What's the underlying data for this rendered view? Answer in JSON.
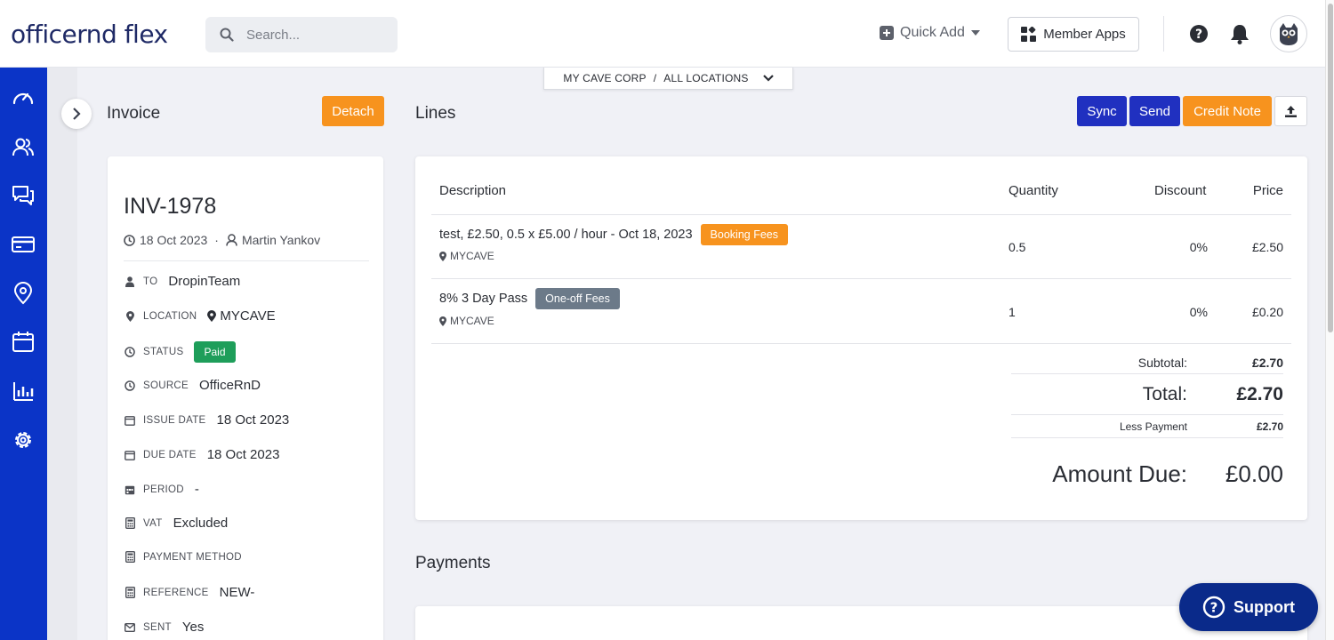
{
  "brand": {
    "logo_text": "officernd flex"
  },
  "header": {
    "search_placeholder": "Search...",
    "quick_add_label": "Quick Add",
    "member_apps_label": "Member Apps"
  },
  "breadcrumb": {
    "company": "MY CAVE CORP",
    "separator": "/",
    "location": "ALL LOCATIONS"
  },
  "invoice": {
    "section_title": "Invoice",
    "detach_label": "Detach",
    "number": "INV-1978",
    "date": "18 Oct 2023",
    "meta_separator": "·",
    "author": "Martin Yankov",
    "fields": {
      "to": {
        "label": "TO",
        "value": "DropinTeam"
      },
      "location": {
        "label": "LOCATION",
        "value": "MYCAVE"
      },
      "status": {
        "label": "STATUS",
        "value": "Paid"
      },
      "source": {
        "label": "SOURCE",
        "value": "OfficeRnD"
      },
      "issue_date": {
        "label": "ISSUE DATE",
        "value": "18 Oct 2023"
      },
      "due_date": {
        "label": "DUE DATE",
        "value": "18 Oct 2023"
      },
      "period": {
        "label": "PERIOD",
        "value": "-"
      },
      "vat": {
        "label": "VAT",
        "value": "Excluded"
      },
      "payment_method": {
        "label": "PAYMENT METHOD",
        "value": ""
      },
      "reference": {
        "label": "REFERENCE",
        "value": "NEW-"
      },
      "sent": {
        "label": "SENT",
        "value": "Yes"
      }
    }
  },
  "lines": {
    "section_title": "Lines",
    "actions": {
      "sync": "Sync",
      "send": "Send",
      "credit_note": "Credit Note"
    },
    "columns": {
      "description": "Description",
      "quantity": "Quantity",
      "discount": "Discount",
      "price": "Price"
    },
    "rows": [
      {
        "description": "test, £2.50, 0.5 x £5.00 / hour - Oct 18, 2023",
        "tag": "Booking Fees",
        "tag_color": "#f7931e",
        "location": "MYCAVE",
        "quantity": "0.5",
        "discount": "0%",
        "price": "£2.50"
      },
      {
        "description": "8% 3 Day Pass",
        "tag": "One-off Fees",
        "tag_color": "#6c7a89",
        "location": "MYCAVE",
        "quantity": "1",
        "discount": "0%",
        "price": "£0.20"
      }
    ],
    "totals": {
      "subtotal_label": "Subtotal:",
      "subtotal": "£2.70",
      "total_label": "Total:",
      "total": "£2.70",
      "less_payment_label": "Less Payment",
      "less_payment": "£2.70",
      "amount_due_label": "Amount Due:",
      "amount_due": "£0.00"
    }
  },
  "payments": {
    "section_title": "Payments"
  },
  "support": {
    "label": "Support"
  },
  "colors": {
    "sidebar": "#0b34c7",
    "accent_orange": "#f7931e",
    "accent_blue": "#2030c0",
    "paid_green": "#1e9e5a"
  }
}
